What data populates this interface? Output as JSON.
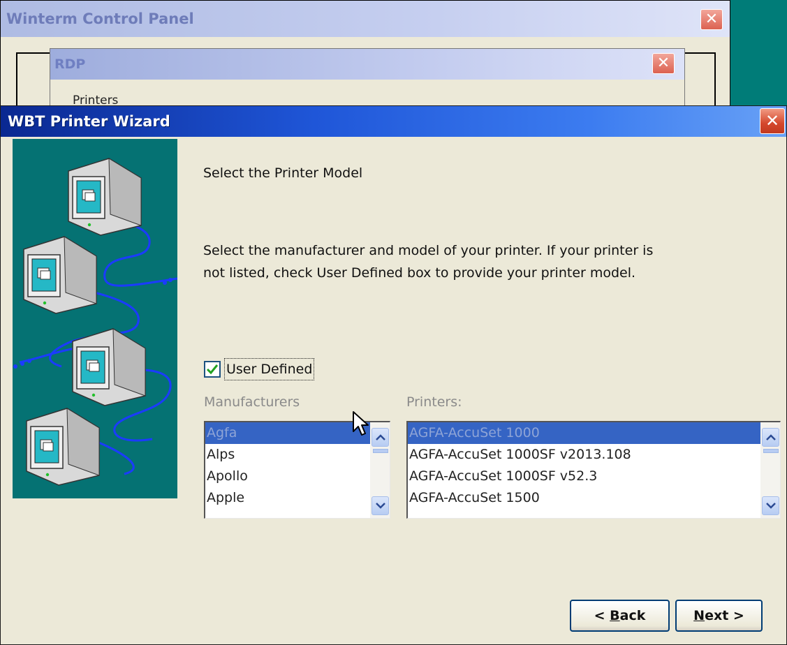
{
  "windows": {
    "control_panel": {
      "title": "Winterm Control Panel",
      "close_glyph": "✕"
    },
    "rdp": {
      "title": "RDP",
      "close_glyph": "✕",
      "section_label": "Printers"
    },
    "wizard": {
      "title": "WBT Printer Wizard",
      "close_glyph": "✕"
    }
  },
  "wizard": {
    "subtitle": "Select the Printer Model",
    "description": "Select the manufacturer and model of your printer. If your printer is not listed, check User Defined box to provide your printer model.",
    "user_defined": {
      "label": "User Defined",
      "checked": true
    },
    "manufacturers_label": "Manufacturers",
    "printers_label": "Printers:",
    "manufacturers": [
      "Agfa",
      "Alps",
      "Apollo",
      "Apple"
    ],
    "printers": [
      "AGFA-AccuSet 1000",
      "AGFA-AccuSet 1000SF v2013.108",
      "AGFA-AccuSet 1000SF v52.3",
      "AGFA-AccuSet 1500"
    ],
    "back_button": {
      "prefix": "< ",
      "accel": "B",
      "rest": "ack"
    },
    "next_button": {
      "accel": "N",
      "rest": "ext >"
    }
  },
  "icons": {
    "close": "close-icon",
    "check": "checkmark-icon",
    "scroll_up": "chevron-up-icon",
    "scroll_down": "chevron-down-icon",
    "illustration": "networked-computers-illustration"
  },
  "colors": {
    "desktop": "#007c78",
    "window_face": "#ece9d8",
    "title_active": "#0a2891",
    "selection": "#3564c4",
    "art_background": "#057273",
    "network_line": "#1b3bff"
  }
}
